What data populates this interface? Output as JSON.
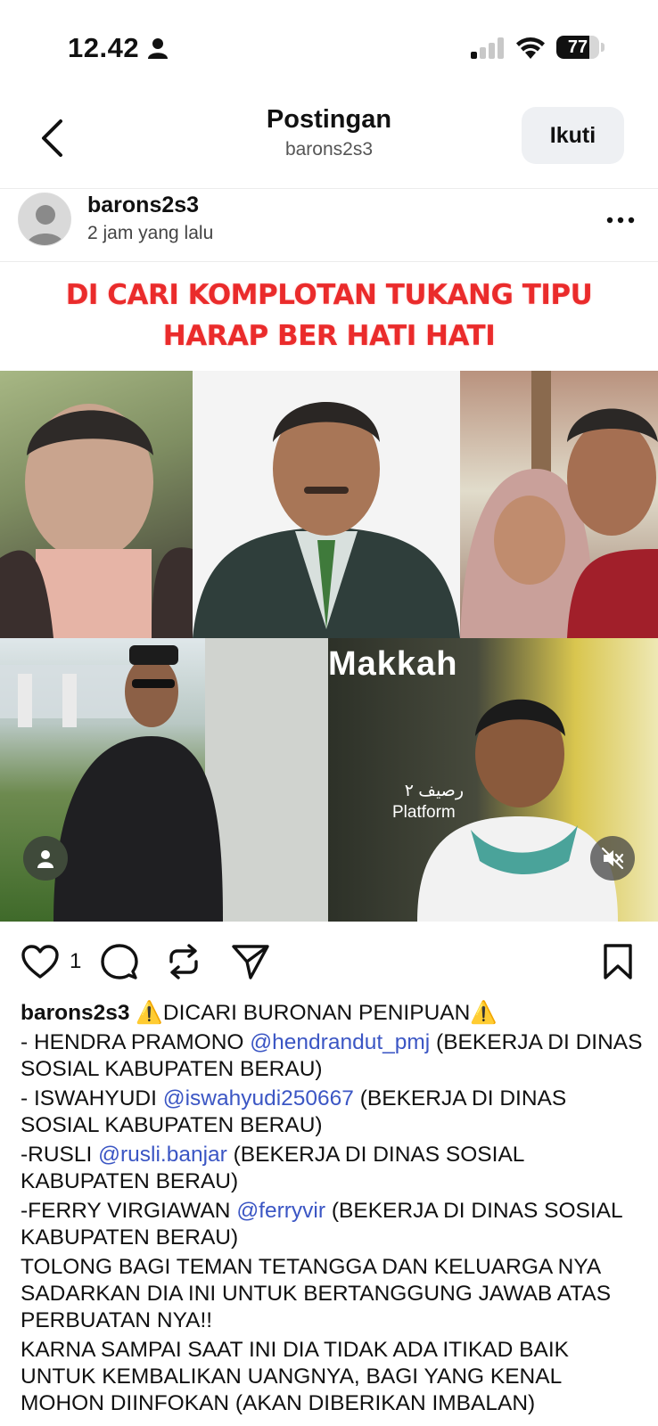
{
  "status_bar": {
    "time": "12.42",
    "battery": "77",
    "battery_fraction": 0.77
  },
  "header": {
    "title": "Postingan",
    "subtitle": "barons2s3",
    "follow_label": "Ikuti"
  },
  "post": {
    "username": "barons2s3",
    "time_ago": "2 jam yang lalu",
    "banner_line1": "DI CARI KOMPLOTAN TUKANG TIPU",
    "banner_line2": "HARAP BER HATI HATI",
    "photo_text_makkah": "Makkah",
    "photo_text_platform_ar": "رصيف ٢",
    "photo_text_platform": "Platform",
    "like_count": "1"
  },
  "caption": {
    "author": "barons2s3",
    "headline": "⚠️DICARI BURONAN PENIPUAN⚠️",
    "lines": [
      {
        "prefix": "- HENDRA PRAMONO ",
        "mention": "@hendrandut_pmj",
        "suffix": " (BEKERJA DI DINAS SOSIAL KABUPATEN BERAU)"
      },
      {
        "prefix": "- ISWAHYUDI ",
        "mention": "@iswahyudi250667",
        "suffix": " (BEKERJA DI DINAS SOSIAL KABUPATEN BERAU)"
      },
      {
        "prefix": "-RUSLI ",
        "mention": "@rusli.banjar",
        "suffix": " (BEKERJA DI DINAS SOSIAL KABUPATEN BERAU)"
      },
      {
        "prefix": "-FERRY VIRGIAWAN ",
        "mention": "@ferryvir",
        "suffix": " (BEKERJA DI DINAS SOSIAL KABUPATEN BERAU)"
      }
    ],
    "paragraph1": "TOLONG BAGI TEMAN TETANGGA DAN KELUARGA NYA SADARKAN DIA INI UNTUK BERTANGGUNG JAWAB ATAS PERBUATAN NYA!!",
    "paragraph2": "KARNA SAMPAI SAAT INI DIA TIDAK ADA ITIKAD BAIK UNTUK KEMBALIKAN UANGNYA, BAGI YANG KENAL MOHON DIINFOKAN (AKAN DIBERIKAN IMBALAN)"
  },
  "colors": {
    "mention": "#3b56c4",
    "banner_red": "#ea2b2b",
    "follow_bg": "#eef0f3"
  },
  "icons": [
    "person-icon",
    "signal-icon",
    "wifi-icon",
    "battery-icon",
    "back-chevron-icon",
    "more-icon",
    "heart-icon",
    "comment-icon",
    "repost-icon",
    "share-icon",
    "bookmark-icon",
    "user-tag-icon",
    "mute-icon"
  ]
}
